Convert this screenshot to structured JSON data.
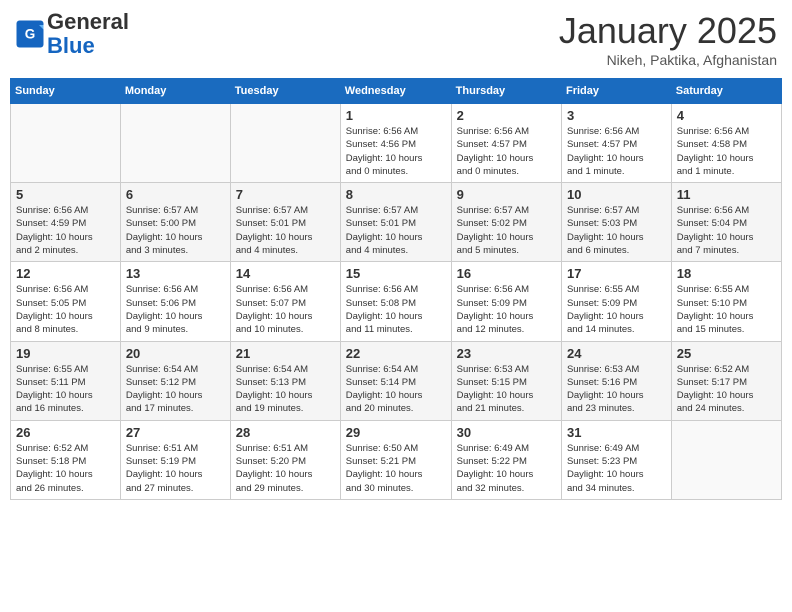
{
  "header": {
    "logo_line1": "General",
    "logo_line2": "Blue",
    "month": "January 2025",
    "location": "Nikeh, Paktika, Afghanistan"
  },
  "days_of_week": [
    "Sunday",
    "Monday",
    "Tuesday",
    "Wednesday",
    "Thursday",
    "Friday",
    "Saturday"
  ],
  "weeks": [
    [
      {
        "day": "",
        "info": ""
      },
      {
        "day": "",
        "info": ""
      },
      {
        "day": "",
        "info": ""
      },
      {
        "day": "1",
        "info": "Sunrise: 6:56 AM\nSunset: 4:56 PM\nDaylight: 10 hours\nand 0 minutes."
      },
      {
        "day": "2",
        "info": "Sunrise: 6:56 AM\nSunset: 4:57 PM\nDaylight: 10 hours\nand 0 minutes."
      },
      {
        "day": "3",
        "info": "Sunrise: 6:56 AM\nSunset: 4:57 PM\nDaylight: 10 hours\nand 1 minute."
      },
      {
        "day": "4",
        "info": "Sunrise: 6:56 AM\nSunset: 4:58 PM\nDaylight: 10 hours\nand 1 minute."
      }
    ],
    [
      {
        "day": "5",
        "info": "Sunrise: 6:56 AM\nSunset: 4:59 PM\nDaylight: 10 hours\nand 2 minutes."
      },
      {
        "day": "6",
        "info": "Sunrise: 6:57 AM\nSunset: 5:00 PM\nDaylight: 10 hours\nand 3 minutes."
      },
      {
        "day": "7",
        "info": "Sunrise: 6:57 AM\nSunset: 5:01 PM\nDaylight: 10 hours\nand 4 minutes."
      },
      {
        "day": "8",
        "info": "Sunrise: 6:57 AM\nSunset: 5:01 PM\nDaylight: 10 hours\nand 4 minutes."
      },
      {
        "day": "9",
        "info": "Sunrise: 6:57 AM\nSunset: 5:02 PM\nDaylight: 10 hours\nand 5 minutes."
      },
      {
        "day": "10",
        "info": "Sunrise: 6:57 AM\nSunset: 5:03 PM\nDaylight: 10 hours\nand 6 minutes."
      },
      {
        "day": "11",
        "info": "Sunrise: 6:56 AM\nSunset: 5:04 PM\nDaylight: 10 hours\nand 7 minutes."
      }
    ],
    [
      {
        "day": "12",
        "info": "Sunrise: 6:56 AM\nSunset: 5:05 PM\nDaylight: 10 hours\nand 8 minutes."
      },
      {
        "day": "13",
        "info": "Sunrise: 6:56 AM\nSunset: 5:06 PM\nDaylight: 10 hours\nand 9 minutes."
      },
      {
        "day": "14",
        "info": "Sunrise: 6:56 AM\nSunset: 5:07 PM\nDaylight: 10 hours\nand 10 minutes."
      },
      {
        "day": "15",
        "info": "Sunrise: 6:56 AM\nSunset: 5:08 PM\nDaylight: 10 hours\nand 11 minutes."
      },
      {
        "day": "16",
        "info": "Sunrise: 6:56 AM\nSunset: 5:09 PM\nDaylight: 10 hours\nand 12 minutes."
      },
      {
        "day": "17",
        "info": "Sunrise: 6:55 AM\nSunset: 5:09 PM\nDaylight: 10 hours\nand 14 minutes."
      },
      {
        "day": "18",
        "info": "Sunrise: 6:55 AM\nSunset: 5:10 PM\nDaylight: 10 hours\nand 15 minutes."
      }
    ],
    [
      {
        "day": "19",
        "info": "Sunrise: 6:55 AM\nSunset: 5:11 PM\nDaylight: 10 hours\nand 16 minutes."
      },
      {
        "day": "20",
        "info": "Sunrise: 6:54 AM\nSunset: 5:12 PM\nDaylight: 10 hours\nand 17 minutes."
      },
      {
        "day": "21",
        "info": "Sunrise: 6:54 AM\nSunset: 5:13 PM\nDaylight: 10 hours\nand 19 minutes."
      },
      {
        "day": "22",
        "info": "Sunrise: 6:54 AM\nSunset: 5:14 PM\nDaylight: 10 hours\nand 20 minutes."
      },
      {
        "day": "23",
        "info": "Sunrise: 6:53 AM\nSunset: 5:15 PM\nDaylight: 10 hours\nand 21 minutes."
      },
      {
        "day": "24",
        "info": "Sunrise: 6:53 AM\nSunset: 5:16 PM\nDaylight: 10 hours\nand 23 minutes."
      },
      {
        "day": "25",
        "info": "Sunrise: 6:52 AM\nSunset: 5:17 PM\nDaylight: 10 hours\nand 24 minutes."
      }
    ],
    [
      {
        "day": "26",
        "info": "Sunrise: 6:52 AM\nSunset: 5:18 PM\nDaylight: 10 hours\nand 26 minutes."
      },
      {
        "day": "27",
        "info": "Sunrise: 6:51 AM\nSunset: 5:19 PM\nDaylight: 10 hours\nand 27 minutes."
      },
      {
        "day": "28",
        "info": "Sunrise: 6:51 AM\nSunset: 5:20 PM\nDaylight: 10 hours\nand 29 minutes."
      },
      {
        "day": "29",
        "info": "Sunrise: 6:50 AM\nSunset: 5:21 PM\nDaylight: 10 hours\nand 30 minutes."
      },
      {
        "day": "30",
        "info": "Sunrise: 6:49 AM\nSunset: 5:22 PM\nDaylight: 10 hours\nand 32 minutes."
      },
      {
        "day": "31",
        "info": "Sunrise: 6:49 AM\nSunset: 5:23 PM\nDaylight: 10 hours\nand 34 minutes."
      },
      {
        "day": "",
        "info": ""
      }
    ]
  ]
}
